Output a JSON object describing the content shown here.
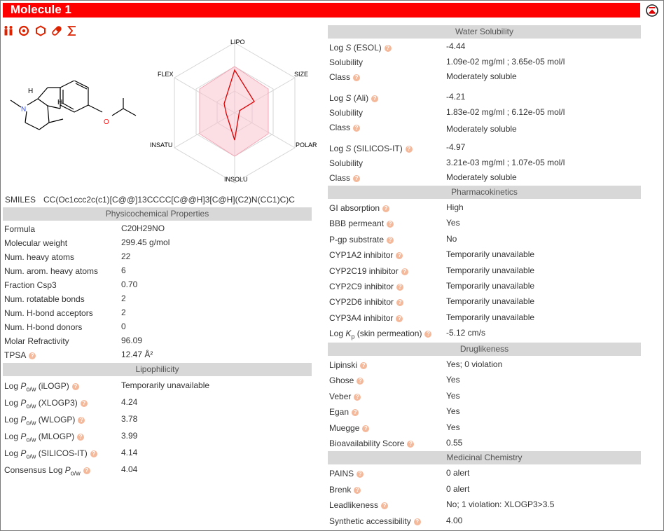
{
  "title": "Molecule 1",
  "toolbar": [
    "people-icon",
    "target-icon",
    "hexagon-icon",
    "pill-icon",
    "sigma-icon"
  ],
  "radar_labels": {
    "lipo": "LIPO",
    "size": "SIZE",
    "polar": "POLAR",
    "insolu": "INSOLU",
    "insatu": "INSATU",
    "flex": "FLEX"
  },
  "smiles": {
    "label": "SMILES",
    "value": "CC(Oc1ccc2c(c1)[C@@]13CCCC[C@@H]3[C@H](C2)N(CC1)C)C"
  },
  "physchem": {
    "header": "Physicochemical Properties",
    "rows": [
      {
        "k": "Formula",
        "v": "C20H29NO"
      },
      {
        "k": "Molecular weight",
        "v": "299.45 g/mol"
      },
      {
        "k": "Num. heavy atoms",
        "v": "22"
      },
      {
        "k": "Num. arom. heavy atoms",
        "v": "6"
      },
      {
        "k": "Fraction Csp3",
        "v": "0.70"
      },
      {
        "k": "Num. rotatable bonds",
        "v": "2"
      },
      {
        "k": "Num. H-bond acceptors",
        "v": "2"
      },
      {
        "k": "Num. H-bond donors",
        "v": "0"
      },
      {
        "k": "Molar Refractivity",
        "v": "96.09"
      },
      {
        "k": "TPSA",
        "v": "12.47 Å²"
      }
    ]
  },
  "lipo": {
    "header": "Lipophilicity",
    "log": "Log",
    "p": "P",
    "sub": "o/w",
    "rows": [
      {
        "m": "(iLOGP)",
        "v": "Temporarily unavailable"
      },
      {
        "m": "(XLOGP3)",
        "v": "4.24"
      },
      {
        "m": "(WLOGP)",
        "v": "3.78"
      },
      {
        "m": "(MLOGP)",
        "v": "3.99"
      },
      {
        "m": "(SILICOS-IT)",
        "v": "4.14"
      }
    ],
    "consensus_label": "Consensus Log",
    "consensus": "4.04"
  },
  "water": {
    "header": "Water Solubility",
    "log": "Log",
    "s": "S",
    "groups": [
      {
        "m": "(ESOL)",
        "logs": "-4.44",
        "sol_k": "Solubility",
        "sol": "1.09e-02 mg/ml ; 3.65e-05 mol/l",
        "cls_k": "Class",
        "cls": "Moderately soluble"
      },
      {
        "m": "(Ali)",
        "logs": "-4.21",
        "sol_k": "Solubility",
        "sol": "1.83e-02 mg/ml ; 6.12e-05 mol/l",
        "cls_k": "Class",
        "cls": "Moderately soluble"
      },
      {
        "m": "(SILICOS-IT)",
        "logs": "-4.97",
        "sol_k": "Solubility",
        "sol": "3.21e-03 mg/ml ; 1.07e-05 mol/l",
        "cls_k": "Class",
        "cls": "Moderately soluble"
      }
    ]
  },
  "pk": {
    "header": "Pharmacokinetics",
    "rows": [
      {
        "k": "GI absorption",
        "v": "High"
      },
      {
        "k": "BBB permeant",
        "v": "Yes"
      },
      {
        "k": "P-gp substrate",
        "v": "No"
      },
      {
        "k": "CYP1A2 inhibitor",
        "v": "Temporarily unavailable"
      },
      {
        "k": "CYP2C19 inhibitor",
        "v": "Temporarily unavailable"
      },
      {
        "k": "CYP2C9 inhibitor",
        "v": "Temporarily unavailable"
      },
      {
        "k": "CYP2D6 inhibitor",
        "v": "Temporarily unavailable"
      },
      {
        "k": "CYP3A4 inhibitor",
        "v": "Temporarily unavailable"
      }
    ],
    "kp_log": "Log",
    "kp_k": "K",
    "kp_sub": "p",
    "kp_label": "(skin permeation)",
    "kp_v": "-5.12 cm/s"
  },
  "drug": {
    "header": "Druglikeness",
    "rows": [
      {
        "k": "Lipinski",
        "v": "Yes; 0 violation"
      },
      {
        "k": "Ghose",
        "v": "Yes"
      },
      {
        "k": "Veber",
        "v": "Yes"
      },
      {
        "k": "Egan",
        "v": "Yes"
      },
      {
        "k": "Muegge",
        "v": "Yes"
      },
      {
        "k": "Bioavailability Score",
        "v": "0.55"
      }
    ]
  },
  "medchem": {
    "header": "Medicinal Chemistry",
    "rows": [
      {
        "k": "PAINS",
        "v": "0 alert"
      },
      {
        "k": "Brenk",
        "v": "0 alert"
      },
      {
        "k": "Leadlikeness",
        "v": "No; 1 violation: XLOGP3>3.5"
      },
      {
        "k": "Synthetic accessibility",
        "v": "4.00"
      }
    ]
  },
  "structure_atoms": {
    "h1": "H",
    "h2": "H",
    "n": "N",
    "o": "O"
  },
  "colors": {
    "titlebar": "#ff0000",
    "header_bg": "#d8d8d8",
    "help": "#f4b89a",
    "radar_fill": "#f9c3cf",
    "radar_line": "#dd0000"
  }
}
